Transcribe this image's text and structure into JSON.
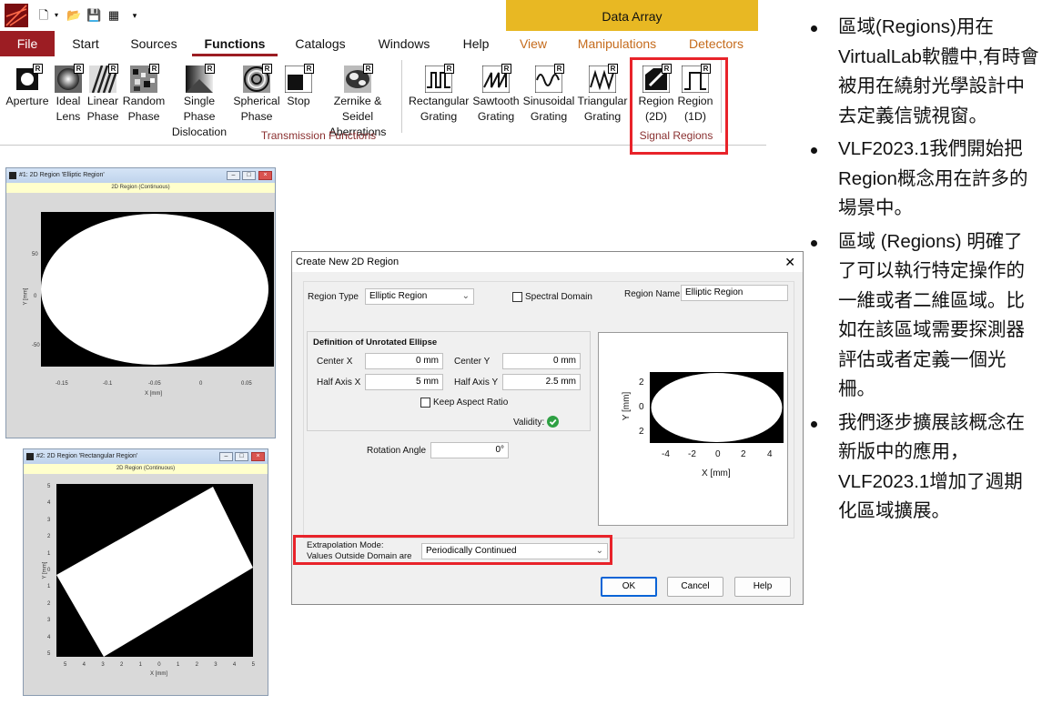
{
  "ribbon": {
    "context_header": "Data Array",
    "tabs": [
      {
        "label": "File"
      },
      {
        "label": "Start"
      },
      {
        "label": "Sources"
      },
      {
        "label": "Functions"
      },
      {
        "label": "Catalogs"
      },
      {
        "label": "Windows"
      },
      {
        "label": "Help"
      },
      {
        "label": "View"
      },
      {
        "label": "Manipulations"
      },
      {
        "label": "Detectors"
      }
    ],
    "buttons": [
      {
        "l1": "Aperture",
        "l2": ""
      },
      {
        "l1": "Ideal",
        "l2": "Lens"
      },
      {
        "l1": "Linear",
        "l2": "Phase"
      },
      {
        "l1": "Random",
        "l2": "Phase"
      },
      {
        "l1": "Single Phase",
        "l2": "Dislocation"
      },
      {
        "l1": "Spherical",
        "l2": "Phase"
      },
      {
        "l1": "Stop",
        "l2": ""
      },
      {
        "l1": "Zernike & Seidel",
        "l2": "Aberrations"
      },
      {
        "l1": "Rectangular",
        "l2": "Grating"
      },
      {
        "l1": "Sawtooth",
        "l2": "Grating"
      },
      {
        "l1": "Sinusoidal",
        "l2": "Grating"
      },
      {
        "l1": "Triangular",
        "l2": "Grating"
      },
      {
        "l1": "Region",
        "l2": "(2D)"
      },
      {
        "l1": "Region",
        "l2": "(1D)"
      }
    ],
    "group_transmission": "Transmission Functions",
    "group_signal": "Signal Regions",
    "badge_letter": "R"
  },
  "win1": {
    "title": "#1: 2D Region 'Elliptic Region'",
    "subtitle": "2D Region (Continuous)",
    "xlabel": "X [mm]",
    "ylabel": "Y [mm]",
    "xticks": [
      "-0.15",
      "-0.1",
      "-0.05",
      "0",
      "0.05"
    ],
    "yticks": [
      "50",
      "0",
      "-50"
    ]
  },
  "win2": {
    "title": "#2: 2D Region 'Rectangular Region'",
    "subtitle": "2D Region (Continuous)",
    "xlabel": "X [mm]",
    "ylabel": "Y [mm]",
    "xticks": [
      "5",
      "4",
      "3",
      "2",
      "1",
      "0",
      "1",
      "2",
      "3",
      "4",
      "5"
    ],
    "yticks": [
      "5",
      "4",
      "3",
      "2",
      "1",
      "0",
      "1",
      "2",
      "3",
      "4",
      "5"
    ]
  },
  "dialog": {
    "title": "Create New 2D Region",
    "close": "✕",
    "region_type_label": "Region Type",
    "region_type_value": "Elliptic Region",
    "spectral_domain_label": "Spectral Domain",
    "region_name_label": "Region Name",
    "region_name_value": "Elliptic Region",
    "definition_label": "Definition of Unrotated Ellipse",
    "center_x_label": "Center X",
    "center_x_value": "0 mm",
    "center_y_label": "Center Y",
    "center_y_value": "0 mm",
    "half_axis_x_label": "Half Axis X",
    "half_axis_x_value": "5 mm",
    "half_axis_y_label": "Half Axis Y",
    "half_axis_y_value": "2.5 mm",
    "keep_aspect_label": "Keep Aspect Ratio",
    "validity_label": "Validity:",
    "rotation_label": "Rotation Angle",
    "rotation_value": "0°",
    "extrap_label1": "Extrapolation Mode:",
    "extrap_label2": "Values Outside Domain are",
    "extrap_value": "Periodically Continued",
    "ok": "OK",
    "cancel": "Cancel",
    "help": "Help",
    "preview": {
      "xlabel": "X [mm]",
      "ylabel": "Y [mm]",
      "xticks": [
        "-4",
        "-2",
        "0",
        "2",
        "4"
      ],
      "yticks": [
        "2",
        "0",
        "2"
      ]
    }
  },
  "notes": [
    "區域(Regions)用在VirtualLab軟體中,有時會被用在繞射光學設計中去定義信號視窗。",
    "VLF2023.1我們開始把Region概念用在許多的場景中。",
    "區域 (Regions) 明確了了可以執行特定操作的一維或者二維區域。比如在該區域需要探測器評估或者定義一個光柵。",
    "我們逐步擴展該概念在新版中的應用，VLF2023.1增加了週期化區域擴展。"
  ],
  "colors": {
    "file_tab": "#9c1d23",
    "context_header": "#e8b823",
    "highlight": "#e8232a",
    "context_tab_text": "#c56b1c"
  }
}
